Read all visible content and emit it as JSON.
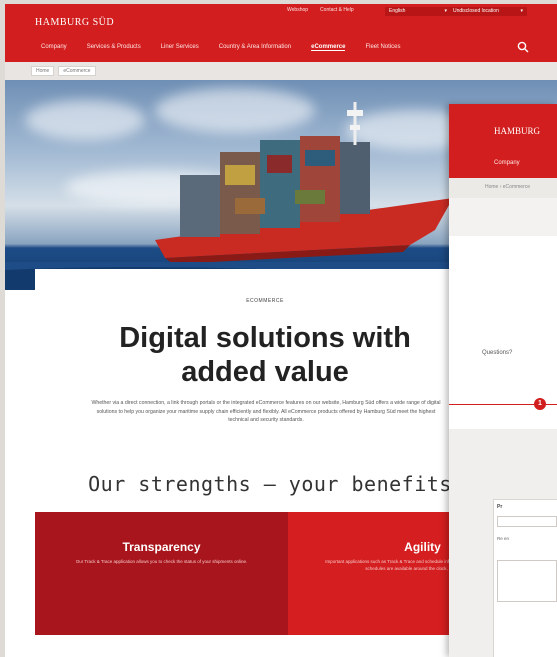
{
  "header": {
    "logo": "HAMBURG SÜD",
    "utility_links": [
      "Webshop",
      "Contact & Help"
    ],
    "language_select": "English",
    "location_select": "Undisclosed location",
    "nav": [
      "Company",
      "Services & Products",
      "Liner Services",
      "Country & Area Information",
      "eCommerce",
      "Fleet Notices"
    ],
    "active_nav": "eCommerce"
  },
  "breadcrumb": [
    "Home",
    "eCommerce"
  ],
  "main": {
    "eyebrow": "ECOMMERCE",
    "headline_line1": "Digital solutions with",
    "headline_line2": "added value",
    "lede": "Whether via a direct connection, a link through portals or the integrated eCommerce features on our website, Hamburg Süd offers a wide range of digital solutions to help you organize your maritime supply chain efficiently and flexibly. All eCommerce products offered by Hamburg Süd meet the highest technical and security standards.",
    "strengths_heading": "Our strengths – your benefits"
  },
  "tiles": [
    {
      "title": "Transparency",
      "text": "Our Track & Trace application allows you to check the status of your shipments online."
    },
    {
      "title": "Agility",
      "text": "Important applications such as Track & Trace and schedule information (point-to-point) and sailing schedules are available around the clock, 24 hours a day."
    }
  ],
  "overlay": {
    "logo": "HAMBURG",
    "nav_item": "Company",
    "breadcrumb": "Home › eCommerce",
    "questions": "Questions?",
    "step": "1",
    "form_label": "Pr",
    "form_text": "Re en"
  },
  "colors": {
    "brand_red": "#d21e1e",
    "dark_red": "#a8151c"
  }
}
